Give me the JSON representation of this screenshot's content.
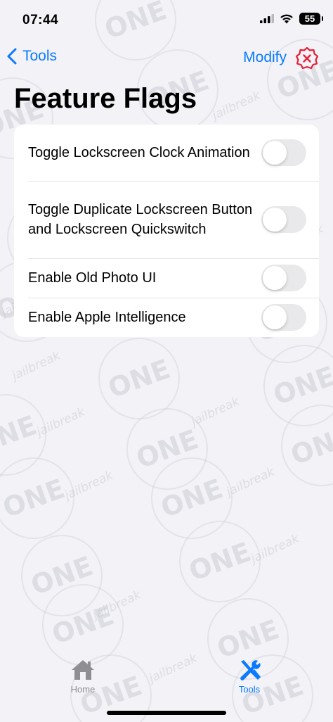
{
  "status_bar": {
    "time": "07:44",
    "battery": "55"
  },
  "nav": {
    "back_label": "Tools",
    "modify_label": "Modify"
  },
  "page": {
    "title": "Feature Flags"
  },
  "flags": [
    {
      "label": "Toggle Lockscreen Clock Animation",
      "enabled": false
    },
    {
      "label": "Toggle Duplicate Lockscreen Button and Lockscreen Quickswitch",
      "enabled": false
    },
    {
      "label": "Enable Old Photo UI",
      "enabled": false
    },
    {
      "label": "Enable Apple Intelligence",
      "enabled": false
    }
  ],
  "tabbar": {
    "home_label": "Home",
    "tools_label": "Tools",
    "active": "tools"
  },
  "watermark": {
    "logo_text": "ONE",
    "tag_text": "jailbreak"
  },
  "colors": {
    "accent": "#0a7aff",
    "destructive": "#e5213a",
    "inactive_tab": "#8e8e93",
    "background": "#f2f2f7",
    "toggle_off": "#e9e9eb"
  },
  "icons": [
    "back-chevron-icon",
    "close-badge-icon",
    "home-icon",
    "tools-icon",
    "wifi-icon",
    "signal-icon",
    "battery-icon"
  ]
}
